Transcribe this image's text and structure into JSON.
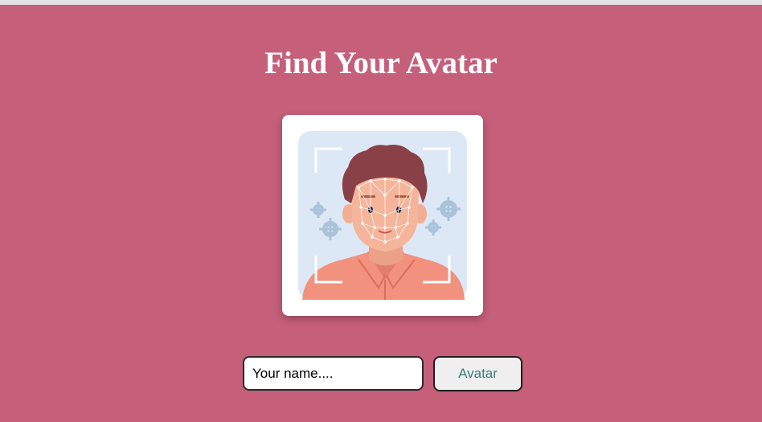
{
  "page": {
    "title": "Find Your Avatar"
  },
  "form": {
    "name_placeholder": "Your name....",
    "name_value": "",
    "submit_label": "Avatar"
  },
  "theme": {
    "background": "#c55f7a",
    "title_color": "#ffffff",
    "button_text_color": "#3d7a7a"
  },
  "illustration": {
    "icon": "face-recognition-avatar-icon"
  }
}
